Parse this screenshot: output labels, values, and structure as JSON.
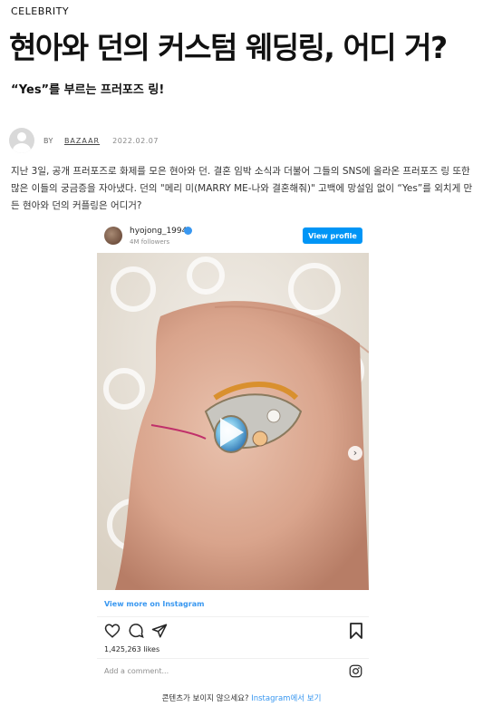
{
  "category": "CELEBRITY",
  "headline": "현아와 던의 커스텀 웨딩링, 어디 거?",
  "subhead": "“Yes”를 부르는 프러포즈 링!",
  "byline": {
    "by": "BY",
    "author": "BAZAAR",
    "date": "2022.02.07"
  },
  "body": "지난 3일, 공개 프러포즈로 화제를 모은 현아와 던. 결혼 임박 소식과 더불어 그들의 SNS에 올라온 프러포즈 링 또한 많은 이들의 궁금증을 자아냈다. 던의 \"메리 미(MARRY ME-나와 결혼해줘)\" 고백에 망설임 없이 “Yes”를 외치게 만든 현아와 던의 커플링은 어디거?",
  "instagram": {
    "username": "hyojong_1994",
    "followers": "4M followers",
    "view_profile": "View profile",
    "view_more": "View more on Instagram",
    "likes": "1,425,263 likes",
    "comment_placeholder": "Add a comment...",
    "carousel": {
      "current": 1,
      "total": 2
    }
  },
  "footer": {
    "text": "콘텐츠가 보이지 않으세요? ",
    "link": "Instagram에서 보기"
  },
  "colors": {
    "accent": "#3897f0",
    "button": "#0095f6"
  },
  "icons": [
    "play-icon",
    "chevron-right-icon",
    "heart-icon",
    "comment-icon",
    "share-icon",
    "bookmark-icon",
    "instagram-icon",
    "verified-icon"
  ]
}
